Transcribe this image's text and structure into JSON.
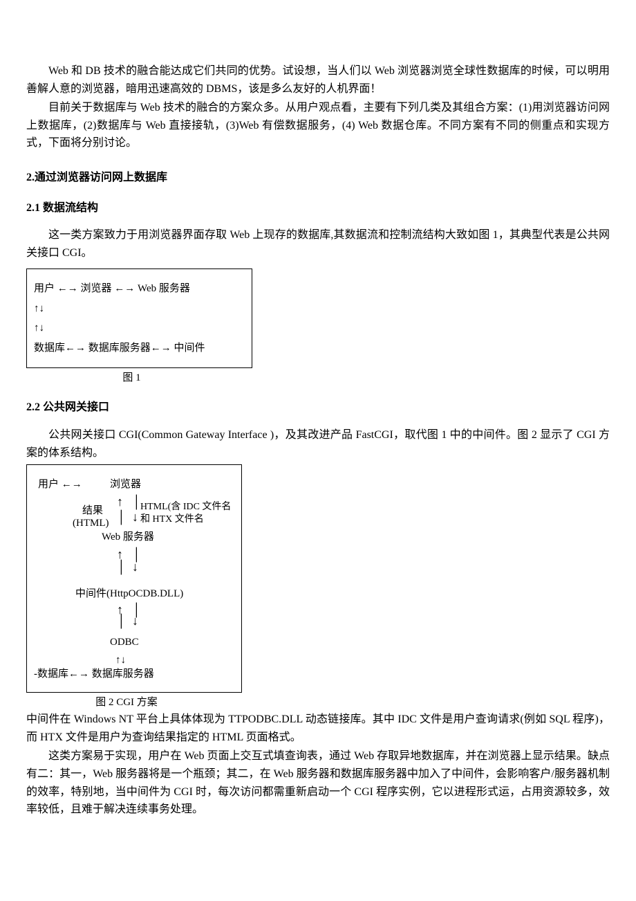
{
  "intro": {
    "p1": "Web 和 DB 技术的融合能达成它们共同的优势。试设想，当人们以 Web 浏览器浏览全球性数据库的时候，可以明用善解人意的浏览器，暗用迅速高效的 DBMS，该是多么友好的人机界面！",
    "p2": "目前关于数据库与 Web 技术的融合的方案众多。从用户观点看，主要有下列几类及其组合方案：(1)用浏览器访问网上数据库，(2)数据库与 Web 直接接轨，(3)Web 有偿数据服务，(4) Web 数据仓库。不同方案有不同的侧重点和实现方式，下面将分别讨论。"
  },
  "s2": {
    "heading": "2.通过浏览器访问网上数据库"
  },
  "s2_1": {
    "heading": "2.1  数据流结构",
    "p1": "这一类方案致力于用浏览器界面存取 Web 上现存的数据库,其数据流和控制流结构大致如图 1，其典型代表是公共网关接口 CGI。",
    "fig1": {
      "row1": "用户 ←→      浏览器  ←→ Web 服务器",
      "row2": "                                               ↑↓",
      "row3": "                                               ↑↓",
      "row4": "数据库←→  数据库服务器←→ 中间件",
      "caption": "图 1"
    }
  },
  "s2_2": {
    "heading": "2.2  公共网关接口",
    "p1": "公共网关接口 CGI(Common Gateway Interface )，及其改进产品 FastCGI，取代图 1 中的中间件。图 2 显示了 CGI 方案的体系结构。",
    "fig2": {
      "user": "用户 ←→",
      "browser": "浏览器",
      "left_result1": "结果",
      "left_result2": "(HTML)",
      "right_html1": "HTML(含 IDC 文件名",
      "right_html2": "和 HTX 文件名",
      "webserver": "Web 服务器",
      "middleware": "中间件(HttpOCDB.DLL)",
      "odbc": "ODBC",
      "arrows_small": "↑↓",
      "db_row": "-数据库←→  数据库服务器",
      "caption": "图  2    CGI 方案"
    },
    "p2": "中间件在 Windows NT 平台上具体体现为 TTPODBC.DLL 动态链接库。其中 IDC 文件是用户查询请求(例如 SQL 程序)，而 HTX 文件是用户为查询结果指定的 HTML 页面格式。",
    "p3": "这类方案易于实现，用户在 Web 页面上交互式填查询表，通过 Web 存取异地数据库，并在浏览器上显示结果。缺点有二：其一，Web 服务器将是一个瓶颈；其二，在 Web 服务器和数据库服务器中加入了中间件，会影响客户/服务器机制的效率，特别地，当中间件为 CGI 时，每次访问都需重新启动一个 CGI 程序实例，它以进程形式运，占用资源较多，效率较低，且难于解决连续事务处理。"
  }
}
